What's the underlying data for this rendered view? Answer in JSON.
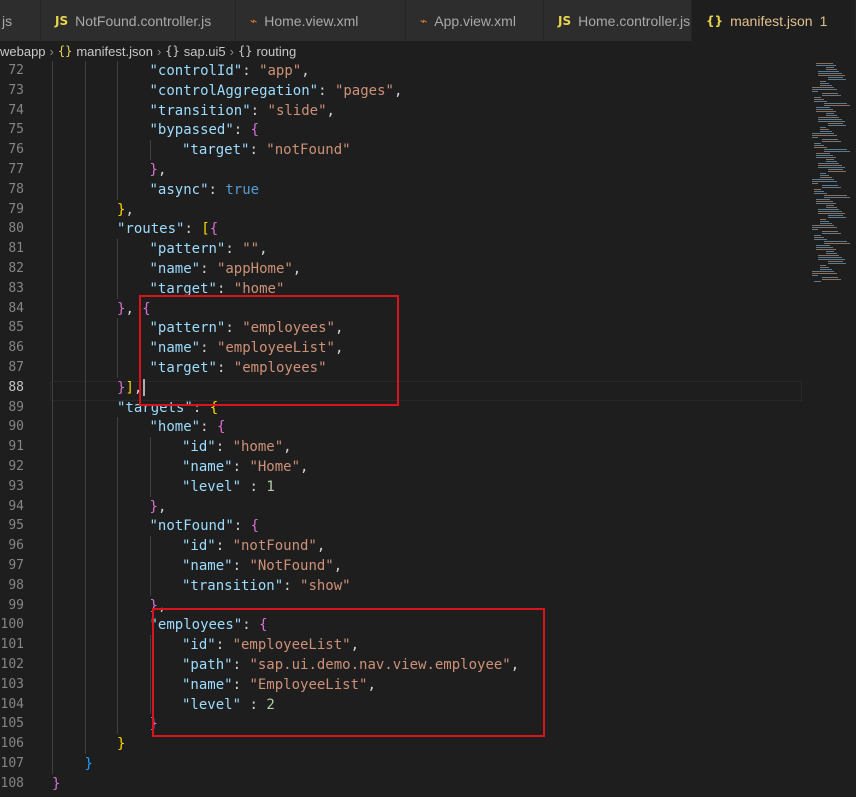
{
  "tabs": [
    {
      "icon": "",
      "label": "js",
      "active": false
    },
    {
      "icon": "JS",
      "label": "NotFound.controller.js",
      "active": false
    },
    {
      "icon": "rss",
      "label": "Home.view.xml",
      "active": false
    },
    {
      "icon": "rss",
      "label": "App.view.xml",
      "active": false
    },
    {
      "icon": "JS",
      "label": "Home.controller.js",
      "active": false
    },
    {
      "icon": "{}",
      "label": "manifest.json",
      "badge": "1",
      "active": true
    }
  ],
  "breadcrumb": {
    "items": [
      "webapp",
      "manifest.json",
      "sap.ui5",
      "routing"
    ]
  },
  "editor": {
    "current_line": 88,
    "lines": [
      {
        "n": 72,
        "d": 4,
        "t": [
          [
            "k",
            "\"controlId\""
          ],
          [
            "p",
            ": "
          ],
          [
            "s",
            "\"app\""
          ],
          [
            "p",
            ","
          ]
        ]
      },
      {
        "n": 73,
        "d": 4,
        "t": [
          [
            "k",
            "\"controlAggregation\""
          ],
          [
            "p",
            ": "
          ],
          [
            "s",
            "\"pages\""
          ],
          [
            "p",
            ","
          ]
        ]
      },
      {
        "n": 74,
        "d": 4,
        "t": [
          [
            "k",
            "\"transition\""
          ],
          [
            "p",
            ": "
          ],
          [
            "s",
            "\"slide\""
          ],
          [
            "p",
            ","
          ]
        ]
      },
      {
        "n": 75,
        "d": 4,
        "t": [
          [
            "k",
            "\"bypassed\""
          ],
          [
            "p",
            ": "
          ],
          [
            "bm",
            "{"
          ]
        ]
      },
      {
        "n": 76,
        "d": 5,
        "t": [
          [
            "k",
            "\"target\""
          ],
          [
            "p",
            ": "
          ],
          [
            "s",
            "\"notFound\""
          ]
        ]
      },
      {
        "n": 77,
        "d": 4,
        "t": [
          [
            "bm",
            "}"
          ],
          [
            "p",
            ","
          ]
        ]
      },
      {
        "n": 78,
        "d": 4,
        "t": [
          [
            "k",
            "\"async\""
          ],
          [
            "p",
            ": "
          ],
          [
            "b",
            "true"
          ]
        ]
      },
      {
        "n": 79,
        "d": 3,
        "t": [
          [
            "by",
            "}"
          ],
          [
            "p",
            ","
          ]
        ]
      },
      {
        "n": 80,
        "d": 3,
        "t": [
          [
            "k",
            "\"routes\""
          ],
          [
            "p",
            ": "
          ],
          [
            "by",
            "["
          ],
          [
            "bm",
            "{"
          ]
        ]
      },
      {
        "n": 81,
        "d": 4,
        "t": [
          [
            "k",
            "\"pattern\""
          ],
          [
            "p",
            ": "
          ],
          [
            "s",
            "\"\""
          ],
          [
            "p",
            ","
          ]
        ]
      },
      {
        "n": 82,
        "d": 4,
        "t": [
          [
            "k",
            "\"name\""
          ],
          [
            "p",
            ": "
          ],
          [
            "s",
            "\"appHome\""
          ],
          [
            "p",
            ","
          ]
        ]
      },
      {
        "n": 83,
        "d": 4,
        "t": [
          [
            "k",
            "\"target\""
          ],
          [
            "p",
            ": "
          ],
          [
            "s",
            "\"home\""
          ]
        ]
      },
      {
        "n": 84,
        "d": 3,
        "t": [
          [
            "bm",
            "}"
          ],
          [
            "p",
            ", "
          ],
          [
            "bm",
            "{"
          ]
        ]
      },
      {
        "n": 85,
        "d": 4,
        "t": [
          [
            "k",
            "\"pattern\""
          ],
          [
            "p",
            ": "
          ],
          [
            "s",
            "\"employees\""
          ],
          [
            "p",
            ","
          ]
        ]
      },
      {
        "n": 86,
        "d": 4,
        "t": [
          [
            "k",
            "\"name\""
          ],
          [
            "p",
            ": "
          ],
          [
            "s",
            "\"employeeList\""
          ],
          [
            "p",
            ","
          ]
        ]
      },
      {
        "n": 87,
        "d": 4,
        "t": [
          [
            "k",
            "\"target\""
          ],
          [
            "p",
            ": "
          ],
          [
            "s",
            "\"employees\""
          ]
        ]
      },
      {
        "n": 88,
        "d": 3,
        "t": [
          [
            "bm",
            "}"
          ],
          [
            "by",
            "]"
          ],
          [
            "p",
            ","
          ]
        ],
        "cursor": true
      },
      {
        "n": 89,
        "d": 3,
        "t": [
          [
            "k",
            "\"targets\""
          ],
          [
            "p",
            ": "
          ],
          [
            "by",
            "{"
          ]
        ]
      },
      {
        "n": 90,
        "d": 4,
        "t": [
          [
            "k",
            "\"home\""
          ],
          [
            "p",
            ": "
          ],
          [
            "bm",
            "{"
          ]
        ]
      },
      {
        "n": 91,
        "d": 5,
        "t": [
          [
            "k",
            "\"id\""
          ],
          [
            "p",
            ": "
          ],
          [
            "s",
            "\"home\""
          ],
          [
            "p",
            ","
          ]
        ]
      },
      {
        "n": 92,
        "d": 5,
        "t": [
          [
            "k",
            "\"name\""
          ],
          [
            "p",
            ": "
          ],
          [
            "s",
            "\"Home\""
          ],
          [
            "p",
            ","
          ]
        ]
      },
      {
        "n": 93,
        "d": 5,
        "t": [
          [
            "k",
            "\"level\""
          ],
          [
            "p",
            " : "
          ],
          [
            "n",
            "1"
          ]
        ]
      },
      {
        "n": 94,
        "d": 4,
        "t": [
          [
            "bm",
            "}"
          ],
          [
            "p",
            ","
          ]
        ]
      },
      {
        "n": 95,
        "d": 4,
        "t": [
          [
            "k",
            "\"notFound\""
          ],
          [
            "p",
            ": "
          ],
          [
            "bm",
            "{"
          ]
        ]
      },
      {
        "n": 96,
        "d": 5,
        "t": [
          [
            "k",
            "\"id\""
          ],
          [
            "p",
            ": "
          ],
          [
            "s",
            "\"notFound\""
          ],
          [
            "p",
            ","
          ]
        ]
      },
      {
        "n": 97,
        "d": 5,
        "t": [
          [
            "k",
            "\"name\""
          ],
          [
            "p",
            ": "
          ],
          [
            "s",
            "\"NotFound\""
          ],
          [
            "p",
            ","
          ]
        ]
      },
      {
        "n": 98,
        "d": 5,
        "t": [
          [
            "k",
            "\"transition\""
          ],
          [
            "p",
            ": "
          ],
          [
            "s",
            "\"show\""
          ]
        ]
      },
      {
        "n": 99,
        "d": 4,
        "t": [
          [
            "bm",
            "}"
          ],
          [
            "p",
            ","
          ]
        ]
      },
      {
        "n": 100,
        "d": 4,
        "t": [
          [
            "k",
            "\"employees\""
          ],
          [
            "p",
            ": "
          ],
          [
            "bm",
            "{"
          ]
        ]
      },
      {
        "n": 101,
        "d": 5,
        "t": [
          [
            "k",
            "\"id\""
          ],
          [
            "p",
            ": "
          ],
          [
            "s",
            "\"employeeList\""
          ],
          [
            "p",
            ","
          ]
        ]
      },
      {
        "n": 102,
        "d": 5,
        "t": [
          [
            "k",
            "\"path\""
          ],
          [
            "p",
            ": "
          ],
          [
            "s",
            "\"sap.ui.demo.nav.view.employee\""
          ],
          [
            "p",
            ","
          ]
        ]
      },
      {
        "n": 103,
        "d": 5,
        "t": [
          [
            "k",
            "\"name\""
          ],
          [
            "p",
            ": "
          ],
          [
            "s",
            "\"EmployeeList\""
          ],
          [
            "p",
            ","
          ]
        ]
      },
      {
        "n": 104,
        "d": 5,
        "t": [
          [
            "k",
            "\"level\""
          ],
          [
            "p",
            " : "
          ],
          [
            "n",
            "2"
          ]
        ]
      },
      {
        "n": 105,
        "d": 4,
        "t": [
          [
            "bm",
            "}"
          ]
        ]
      },
      {
        "n": 106,
        "d": 3,
        "t": [
          [
            "by",
            "}"
          ]
        ]
      },
      {
        "n": 107,
        "d": 2,
        "t": [
          [
            "bb",
            "}"
          ]
        ]
      },
      {
        "n": 108,
        "d": 1,
        "t": [
          [
            "bm",
            "}"
          ]
        ]
      }
    ]
  }
}
